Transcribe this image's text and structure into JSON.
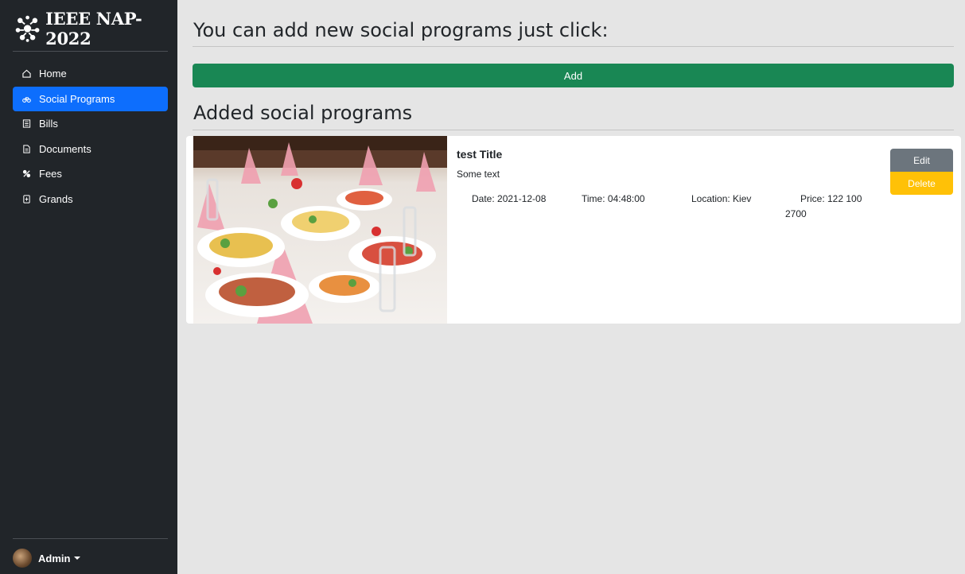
{
  "sidebar": {
    "brand": "IEEE NAP-2022",
    "items": [
      {
        "label": "Home",
        "icon": "house-icon"
      },
      {
        "label": "Social Programs",
        "icon": "bicycle-icon"
      },
      {
        "label": "Bills",
        "icon": "receipt-icon"
      },
      {
        "label": "Documents",
        "icon": "document-icon"
      },
      {
        "label": "Fees",
        "icon": "percent-icon"
      },
      {
        "label": "Grands",
        "icon": "file-icon"
      }
    ],
    "active_item": "Social Programs",
    "user": "Admin"
  },
  "main": {
    "prompt_heading": "You can add new social programs just click:",
    "add_label": "Add",
    "added_heading": "Added social programs"
  },
  "program": {
    "title": "test Title",
    "text": "Some text",
    "date": "Date: 2021-12-08",
    "time": "Time: 04:48:00",
    "location": "Location: Kiev",
    "price_line1": "Price: 122 100",
    "price_line2": "2700",
    "edit_label": "Edit",
    "delete_label": "Delete"
  },
  "colors": {
    "sidebar": "#212529",
    "active": "#0d6efd",
    "add": "#198754",
    "edit": "#6c757d",
    "delete": "#ffc107"
  }
}
